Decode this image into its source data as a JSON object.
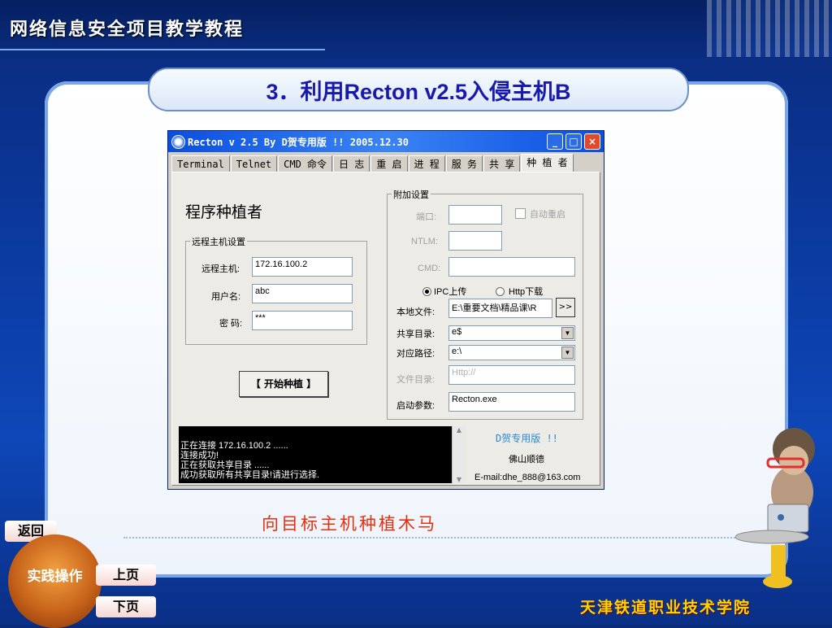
{
  "slide": {
    "header_title": "网络信息安全项目教学教程",
    "title": "3．利用Recton v2.5入侵主机B",
    "caption": "向目标主机种植木马",
    "school": "天津铁道职业技术学院"
  },
  "nav": {
    "back": "返回",
    "practice": "实践操作",
    "prev": "上页",
    "next": "下页"
  },
  "window": {
    "title": "Recton v 2.5  By  D贺专用版 !!  2005.12.30",
    "tabs": [
      "Terminal",
      "Telnet",
      "CMD 命令",
      "日 志",
      "重 启",
      "进 程",
      "服 务",
      "共 享",
      "种 植 者"
    ],
    "active_tab": "种 植 者",
    "heading": "程序种植者",
    "remote_group": {
      "caption": "远程主机设置",
      "host_label": "远程主机:",
      "host_value": "172.16.100.2",
      "user_label": "用户名:",
      "user_value": "abc",
      "pass_label": "密 码:",
      "pass_value": "***"
    },
    "start_button": "【 开始种植 】",
    "extra_group": {
      "caption": "附加设置",
      "port_label": "端口:",
      "auto_restart_label": "自动重启",
      "ntlm_label": "NTLM:",
      "cmd_label": "CMD:",
      "ipc_label": "IPC上传",
      "http_label": "Http下载",
      "local_file_label": "本地文件:",
      "local_file_value": "E:\\重要文档\\精品课\\R",
      "browse": ">>",
      "share_label": "共享目录:",
      "share_value": "e$",
      "path_label": "对应路径:",
      "path_value": "e:\\",
      "file_dir_label": "文件目录:",
      "file_dir_value": "Http://",
      "params_label": "启动参数:",
      "params_value": "Recton.exe"
    },
    "log_lines": [
      "正在连接 172.16.100.2 ......",
      "连接成功!",
      "正在获取共享目录 ......",
      "成功获取所有共享目录!请进行选择."
    ],
    "credit": {
      "name": "D贺专用版 !!",
      "place": "佛山顺德",
      "email": "E-mail:dhe_888@163.com"
    }
  },
  "colors": {
    "title_text": "#1a1aaa",
    "caption": "#e53010",
    "school": "#ffd400"
  }
}
